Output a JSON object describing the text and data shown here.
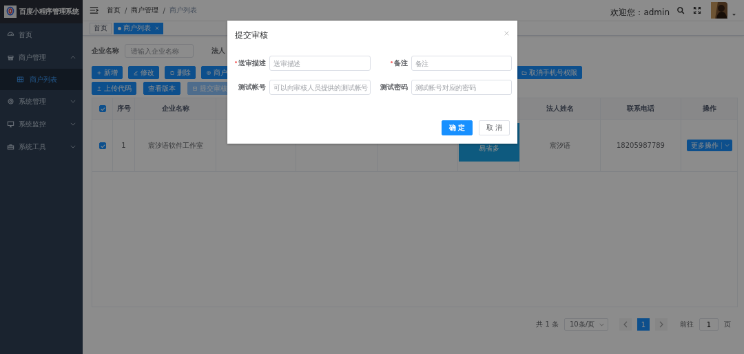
{
  "sidebar": {
    "title": "百度小程序管理系统",
    "items": [
      {
        "label": "首页",
        "kind": "dashboard",
        "selected": false
      },
      {
        "label": "商户管理",
        "kind": "shop",
        "expanded": true,
        "selected": false,
        "children": [
          {
            "label": "商户列表",
            "selected": true
          }
        ]
      },
      {
        "label": "系统管理",
        "kind": "gear",
        "expanded": false,
        "selected": false
      },
      {
        "label": "系统监控",
        "kind": "monitor",
        "expanded": false,
        "selected": false
      },
      {
        "label": "系统工具",
        "kind": "toolbox",
        "expanded": false,
        "selected": false
      }
    ]
  },
  "breadcrumb": {
    "separator": "/",
    "items": [
      "首页",
      "商户管理",
      "商户列表"
    ]
  },
  "user": {
    "welcome": "欢迎您：admin"
  },
  "tabs": [
    {
      "label": "首页",
      "selected": false
    },
    {
      "label": "商户列表",
      "selected": true
    }
  ],
  "search": {
    "fields": [
      {
        "label": "企业名称",
        "placeholder": "请输入企业名称"
      },
      {
        "label": "法人"
      }
    ]
  },
  "toolbar": {
    "row_1": [
      {
        "label": "新增",
        "kind": "plus"
      },
      {
        "label": "修改",
        "kind": "edit"
      },
      {
        "label": "删除",
        "kind": "trash"
      },
      {
        "label": "商户",
        "kind": "target"
      }
    ],
    "row_1_right": [
      {
        "label": "取消手机号权限",
        "kind": "folder"
      }
    ],
    "row_2": [
      {
        "label": "上传代码",
        "kind": "upload",
        "disabled": false
      },
      {
        "label": "查看版本",
        "kind": "text",
        "disabled": false
      },
      {
        "label": "提交审核",
        "kind": "save",
        "disabled": true
      }
    ]
  },
  "table": {
    "header_checked": true,
    "columns": [
      "序号",
      "企业名称",
      "法人姓名",
      "联系电话",
      "操作"
    ],
    "rows": [
      {
        "checked": true,
        "index": "1",
        "company": "宸汐语软件工作室",
        "logo_text": "易省多",
        "legal_person": "宸汐语",
        "phone": "18205987789",
        "action": "更多操作"
      }
    ]
  },
  "pagination": {
    "total": "共 1 条",
    "page_size": "10条/页",
    "pages": [
      {
        "label": "1",
        "selected": true
      }
    ],
    "goto_label": "前往",
    "goto_value": "1",
    "goto_suffix": "页"
  },
  "dialog": {
    "title": "提交审核",
    "fields": [
      {
        "label": "送审描述",
        "required": true,
        "placeholder": "送审描述"
      },
      {
        "label": "备注",
        "required": true,
        "placeholder": "备注"
      },
      {
        "label": "测试帐号",
        "required": false,
        "placeholder": "可以向审核人员提供的测试帐号"
      },
      {
        "label": "测试密码",
        "required": false,
        "placeholder": "测试帐号对应的密码"
      }
    ],
    "buttons": [
      {
        "label": "确 定",
        "kind": "primary"
      },
      {
        "label": "取 消",
        "kind": "default"
      }
    ]
  }
}
